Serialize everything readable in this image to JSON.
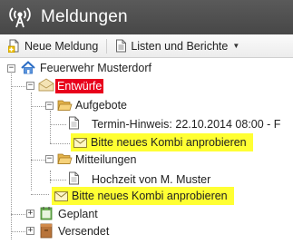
{
  "window": {
    "title": "Meldungen"
  },
  "toolbar": {
    "new_message_label": "Neue Meldung",
    "lists_reports_label": "Listen und Berichte"
  },
  "tree": {
    "root": "Feuerwehr Musterdorf",
    "drafts": "Entwürfe",
    "aufgebote": "Aufgebote",
    "termin": "Termin-Hinweis: 22.10.2014 08:00 - F",
    "kombi_1": "Bitte neues Kombi anprobieren",
    "mitteilungen": "Mitteilungen",
    "hochzeit": "Hochzeit von M. Muster",
    "kombi_2": "Bitte neues Kombi anprobieren",
    "geplant": "Geplant",
    "versendet": "Versendet"
  },
  "colors": {
    "selected_bg": "#e8001c",
    "highlight_bg": "#ffff33",
    "titlebar_bg": "#4f4f4f"
  }
}
